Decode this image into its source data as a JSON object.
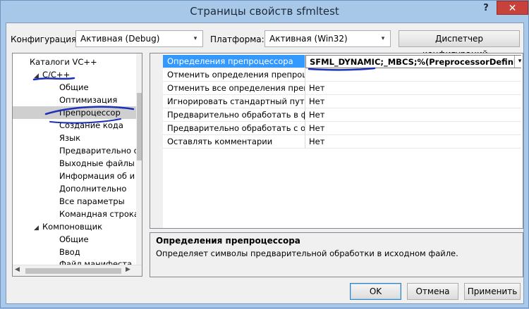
{
  "window": {
    "title": "Страницы свойств sfmltest",
    "help": "?",
    "close": "✕"
  },
  "toolbar": {
    "config_label": "Конфигурация:",
    "config_value": "Активная (Debug)",
    "platform_label": "Платформа:",
    "platform_value": "Активная (Win32)",
    "config_manager": "Диспетчер конфигураций..."
  },
  "tree": {
    "items": [
      {
        "label": "Каталоги VC++"
      },
      {
        "label": "C/C++",
        "expanded": true
      },
      {
        "label": "Общие"
      },
      {
        "label": "Оптимизация"
      },
      {
        "label": "Препроцессор",
        "selected": true
      },
      {
        "label": "Создание кода"
      },
      {
        "label": "Язык"
      },
      {
        "label": "Предварительно от"
      },
      {
        "label": "Выходные файлы"
      },
      {
        "label": "Информация об и"
      },
      {
        "label": "Дополнительно"
      },
      {
        "label": "Все параметры"
      },
      {
        "label": "Командная строка"
      },
      {
        "label": "Компоновщик",
        "expanded": true
      },
      {
        "label": "Общие"
      },
      {
        "label": "Ввод"
      },
      {
        "label": "Файл манифеста"
      }
    ]
  },
  "grid": {
    "rows": [
      {
        "name": "Определения препроцессора",
        "value": "SFML_DYNAMIC;_MBCS;%(PreprocessorDefinitions)",
        "selected": true
      },
      {
        "name": "Отменить определения препроцесс",
        "value": ""
      },
      {
        "name": "Отменить все определения препроц",
        "value": "Нет"
      },
      {
        "name": "Игнорировать стандартный путь вкл",
        "value": "Нет"
      },
      {
        "name": "Предварительно обработать в файл",
        "value": "Нет"
      },
      {
        "name": "Предварительно обработать с отме",
        "value": "Нет"
      },
      {
        "name": "Оставлять комментарии",
        "value": "Нет"
      }
    ]
  },
  "description": {
    "title": "Определения препроцессора",
    "text": "Определяет символы предварительной обработки в исходном файле."
  },
  "buttons": {
    "ok": "OK",
    "cancel": "Отмена",
    "apply": "Применить"
  },
  "colors": {
    "accent_selected": "#3399ff",
    "annotation_pen": "#1b2fb8",
    "close_button": "#c7423a"
  },
  "icons": {
    "expanded": "triangle-down-right-icon",
    "collapsed": "triangle-down-right-icon",
    "dropdown": "chevron-down-icon"
  }
}
